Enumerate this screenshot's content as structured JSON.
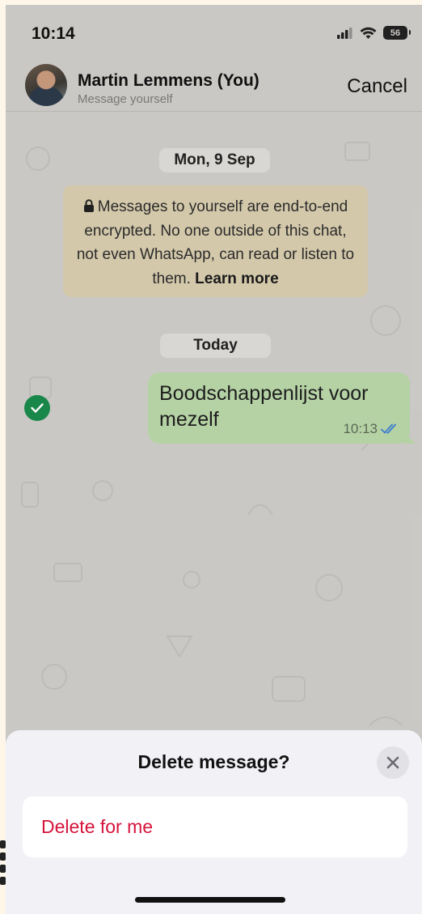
{
  "status_bar": {
    "time": "10:14",
    "battery": "56"
  },
  "header": {
    "contact_name": "Martin Lemmens (You)",
    "subtitle": "Message yourself",
    "cancel_label": "Cancel"
  },
  "chat": {
    "date_chips": [
      "Mon, 9 Sep",
      "Today"
    ],
    "encryption_notice": {
      "text": "Messages to yourself are end-to-end encrypted. No one outside of this chat, not even WhatsApp, can read or listen to them.",
      "link": "Learn more"
    },
    "messages": [
      {
        "text": "Boodschappenlijst voor mezelf",
        "time": "10:13",
        "status": "read",
        "selected": true
      }
    ]
  },
  "sheet": {
    "title": "Delete message?",
    "options": [
      "Delete for me"
    ],
    "close_icon": "close-icon"
  },
  "colors": {
    "bubble": "#b9d7a9",
    "notice": "#d8ccae",
    "destructive": "#d5133b",
    "check": "#1a8a4c",
    "read_ticks": "#3a7fd5"
  }
}
